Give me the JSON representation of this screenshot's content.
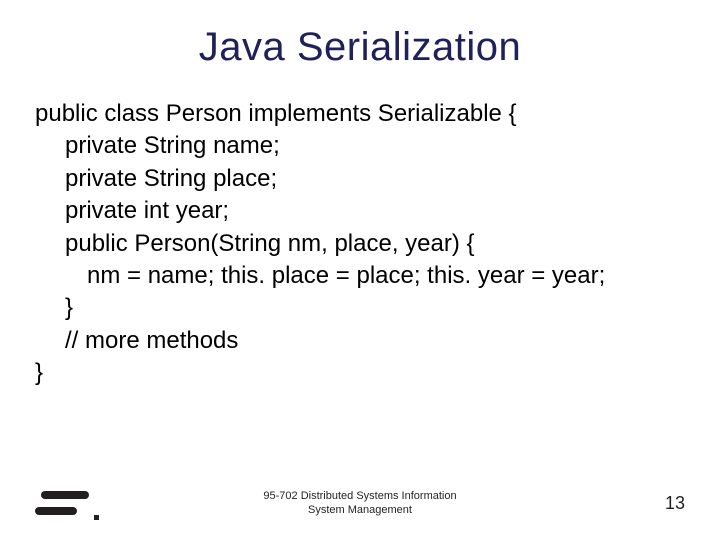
{
  "title": "Java Serialization",
  "code": {
    "l1": "public class Person implements Serializable {",
    "l2": "private String name;",
    "l3": "private String place;",
    "l4": "private int year;",
    "l5": "public Person(String nm, place, year) {",
    "l6": "nm = name; this. place = place; this. year = year;",
    "l7": "}",
    "l8": "// more methods",
    "l9": "}"
  },
  "footer": {
    "course_line1": "95-702 Distributed Systems Information",
    "course_line2": "System Management",
    "page": "13"
  }
}
